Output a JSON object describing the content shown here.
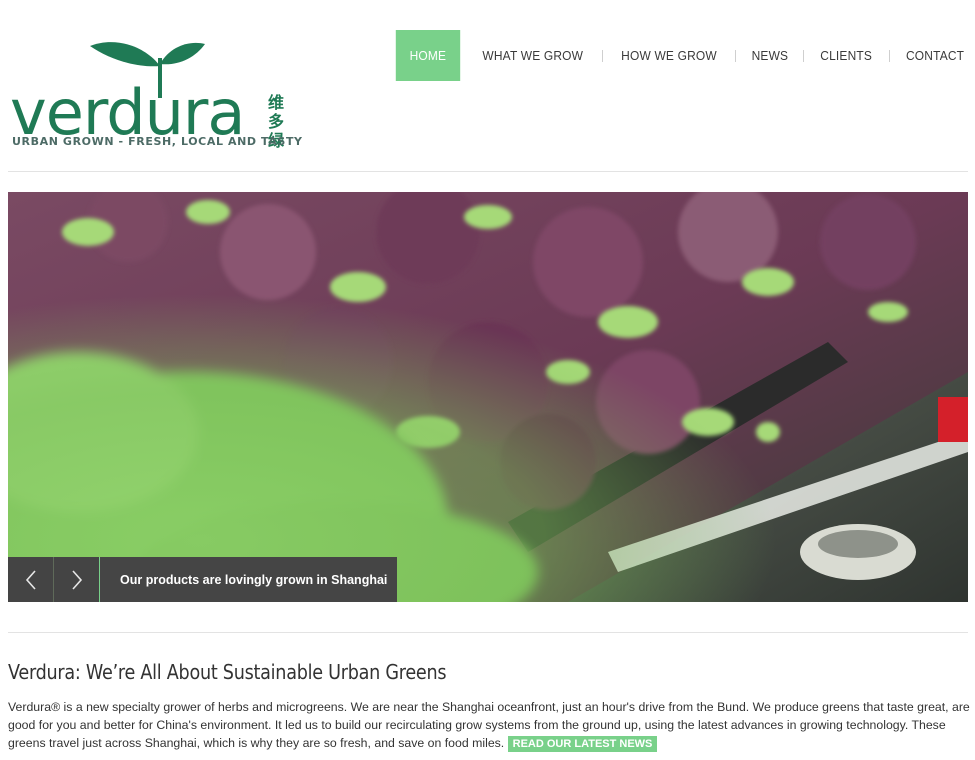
{
  "brand": {
    "name": "verdura",
    "tagline": "URBAN GROWN - FRESH, LOCAL AND TASTY",
    "chinese": [
      "维",
      "多",
      "绿"
    ],
    "color": "#1f7a55"
  },
  "nav": {
    "items": [
      "HOME",
      "WHAT WE GROW",
      "HOW WE GROW",
      "NEWS",
      "CLIENTS",
      "CONTACT"
    ],
    "active": "HOME",
    "active_color": "#79d18a"
  },
  "slider": {
    "caption": "Our products are lovingly grown in Shanghai",
    "prev_icon": "chevron-left-icon",
    "next_icon": "chevron-right-icon"
  },
  "intro": {
    "title": "Verdura: We’re All About Sustainable Urban Greens",
    "body": "Verdura® is a new specialty grower of herbs and microgreens. We are near the Shanghai oceanfront, just an hour's drive from the Bund. We produce greens that taste great, are good for you and better for China's environment. It led us to build our recirculating grow systems from the ground up, using the latest advances in growing technology. These greens travel just across Shanghai, which is why they are so fresh, and save on food miles.",
    "button": "READ OUR LATEST NEWS"
  }
}
